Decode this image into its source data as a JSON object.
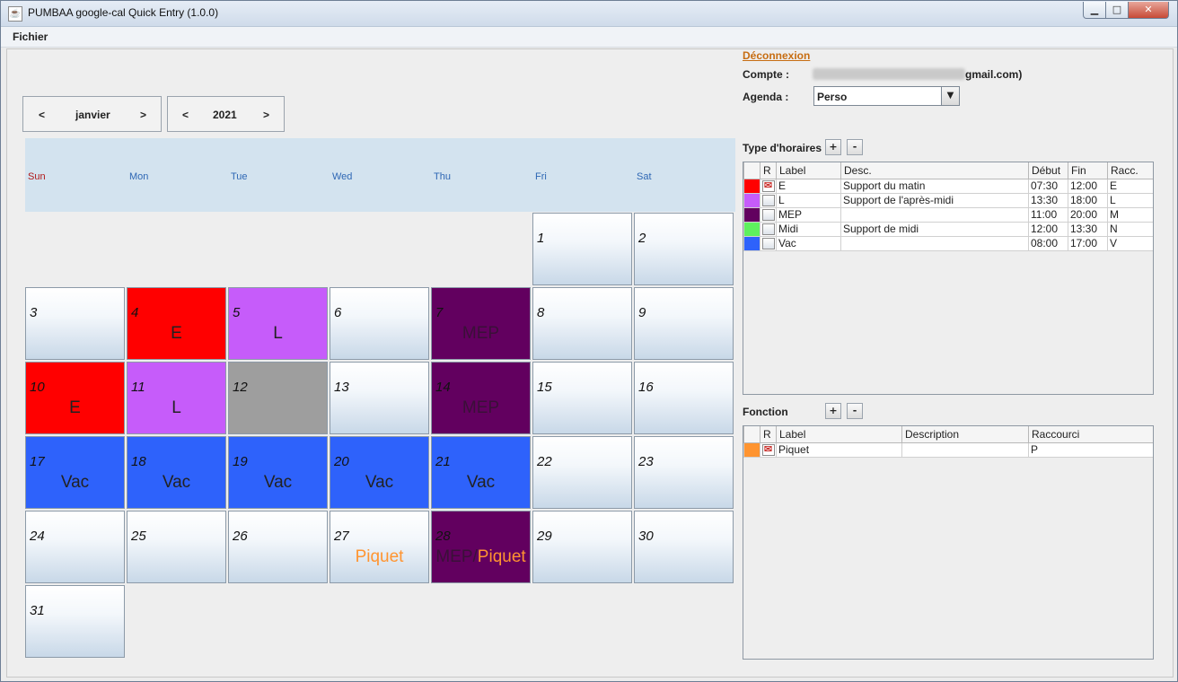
{
  "window": {
    "title": "PUMBAA google-cal Quick Entry (1.0.0)"
  },
  "menu": [
    "Fichier"
  ],
  "nav": {
    "month": {
      "prev": "<",
      "value": "janvier",
      "next": ">"
    },
    "year": {
      "prev": "<",
      "value": "2021",
      "next": ">"
    }
  },
  "weekdays": [
    "Sun",
    "Mon",
    "Tue",
    "Wed",
    "Thu",
    "Fri",
    "Sat"
  ],
  "colors": {
    "E": "#ff0000",
    "L": "#c65cfa",
    "MEP": "#62005f",
    "Midi": "#5ef05e",
    "Vac": "#2e62fb",
    "Piquet": "#ff9430",
    "unavailable": "#9e9e9e"
  },
  "days": [
    {
      "d": "1",
      "labels": []
    },
    {
      "d": "2",
      "labels": []
    },
    {
      "d": "3",
      "labels": []
    },
    {
      "d": "4",
      "labels": [
        "E"
      ]
    },
    {
      "d": "5",
      "labels": [
        "L"
      ]
    },
    {
      "d": "6",
      "labels": []
    },
    {
      "d": "7",
      "labels": [
        "MEP"
      ]
    },
    {
      "d": "8",
      "labels": []
    },
    {
      "d": "9",
      "labels": []
    },
    {
      "d": "10",
      "labels": [
        "E"
      ]
    },
    {
      "d": "11",
      "labels": [
        "L"
      ]
    },
    {
      "d": "12",
      "labels": []
    },
    {
      "d": "13",
      "labels": []
    },
    {
      "d": "14",
      "labels": [
        "MEP"
      ]
    },
    {
      "d": "15",
      "labels": []
    },
    {
      "d": "16",
      "labels": []
    },
    {
      "d": "17",
      "labels": [
        "Vac"
      ]
    },
    {
      "d": "18",
      "labels": [
        "Vac"
      ]
    },
    {
      "d": "19",
      "labels": [
        "Vac"
      ]
    },
    {
      "d": "20",
      "labels": [
        "Vac"
      ]
    },
    {
      "d": "21",
      "labels": [
        "Vac"
      ]
    },
    {
      "d": "22",
      "labels": []
    },
    {
      "d": "23",
      "labels": []
    },
    {
      "d": "24",
      "labels": []
    },
    {
      "d": "25",
      "labels": []
    },
    {
      "d": "26",
      "labels": []
    },
    {
      "d": "27",
      "labels": [
        "Piquet"
      ]
    },
    {
      "d": "28",
      "labels": [
        "MEP",
        "Piquet"
      ]
    },
    {
      "d": "29",
      "labels": []
    },
    {
      "d": "30",
      "labels": []
    },
    {
      "d": "31",
      "labels": []
    }
  ],
  "account": {
    "logout": "Déconnexion",
    "compte_label": "Compte :",
    "compte_value_visible": "gmail.com)",
    "agenda_label": "Agenda :",
    "agenda_value": "Perso"
  },
  "schedule_types": {
    "title": "Type d'horaires",
    "add": "+",
    "remove": "-",
    "columns": [
      "",
      "R",
      "Label",
      "Desc.",
      "Début",
      "Fin",
      "Racc."
    ],
    "rows": [
      {
        "color": "#ff0000",
        "checked": true,
        "label": "E",
        "desc": "Support du matin",
        "start": "07:30",
        "end": "12:00",
        "shortcut": "E"
      },
      {
        "color": "#c65cfa",
        "checked": false,
        "label": "L",
        "desc": "Support de l'après-midi",
        "start": "13:30",
        "end": "18:00",
        "shortcut": "L"
      },
      {
        "color": "#62005f",
        "checked": false,
        "label": "MEP",
        "desc": "",
        "start": "11:00",
        "end": "20:00",
        "shortcut": "M"
      },
      {
        "color": "#5ef05e",
        "checked": false,
        "label": "Midi",
        "desc": "Support de midi",
        "start": "12:00",
        "end": "13:30",
        "shortcut": "N"
      },
      {
        "color": "#2e62fb",
        "checked": false,
        "label": "Vac",
        "desc": "",
        "start": "08:00",
        "end": "17:00",
        "shortcut": "V"
      }
    ]
  },
  "functions": {
    "title": "Fonction",
    "add": "+",
    "remove": "-",
    "columns": [
      "",
      "R",
      "Label",
      "Description",
      "Raccourci"
    ],
    "rows": [
      {
        "color": "#ff9430",
        "checked": true,
        "label": "Piquet",
        "desc": "",
        "shortcut": "P"
      }
    ]
  }
}
